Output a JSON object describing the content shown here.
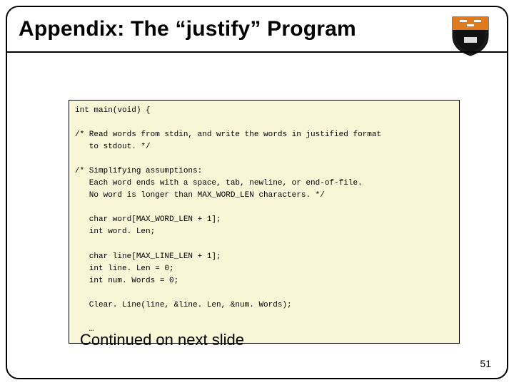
{
  "title": "Appendix: The “justify” Program",
  "code": "int main(void) {\n\n/* Read words from stdin, and write the words in justified format\n   to stdout. */\n\n/* Simplifying assumptions:\n   Each word ends with a space, tab, newline, or end-of-file.\n   No word is longer than MAX_WORD_LEN characters. */\n\n   char word[MAX_WORD_LEN + 1];\n   int word. Len;\n\n   char line[MAX_LINE_LEN + 1];\n   int line. Len = 0;\n   int num. Words = 0;\n\n   Clear. Line(line, &line. Len, &num. Words);\n\n   …",
  "continued": "Continued on next slide",
  "pagenum": "51",
  "crest_alt": "Princeton shield crest"
}
